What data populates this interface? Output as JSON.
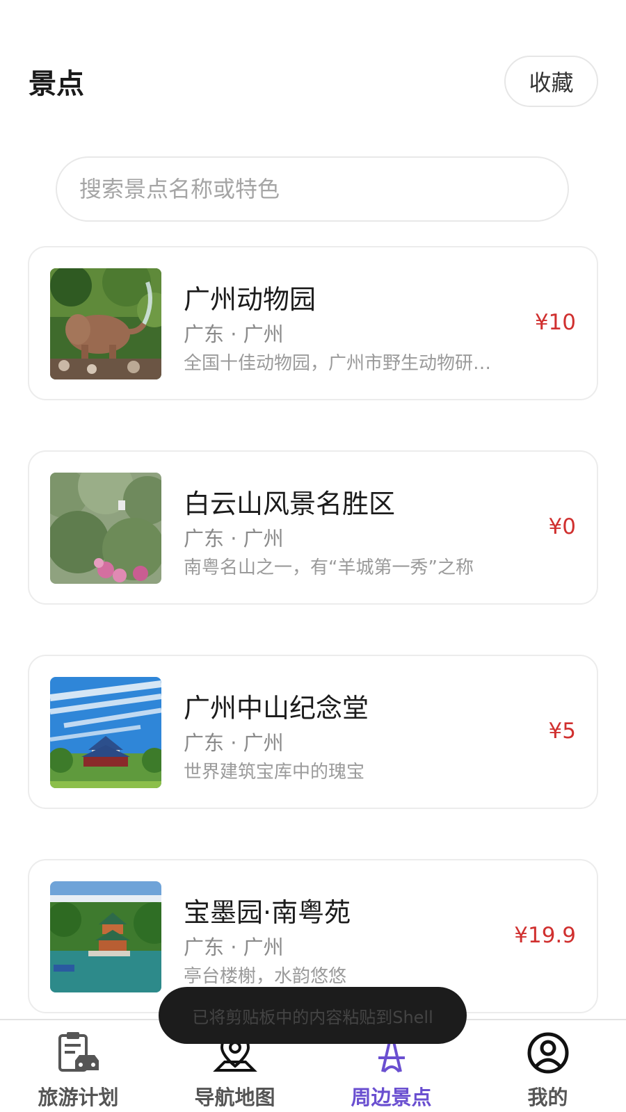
{
  "header": {
    "title": "景点",
    "favorite_label": "收藏"
  },
  "search": {
    "placeholder": "搜索景点名称或特色"
  },
  "attractions": [
    {
      "name": "广州动物园",
      "location": "广东 · 广州",
      "desc": "全国十佳动物园，广州市野生动物研…",
      "price": "¥10"
    },
    {
      "name": "白云山风景名胜区",
      "location": "广东 · 广州",
      "desc": "南粤名山之一，有“羊城第一秀”之称",
      "price": "¥0"
    },
    {
      "name": "广州中山纪念堂",
      "location": "广东 · 广州",
      "desc": "世界建筑宝库中的瑰宝",
      "price": "¥5"
    },
    {
      "name": "宝墨园·南粤苑",
      "location": "广东 · 广州",
      "desc": "亭台楼榭，水韵悠悠",
      "price": "¥19.9"
    }
  ],
  "tabs": [
    {
      "label": "旅游计划",
      "icon": "clipboard-car-icon"
    },
    {
      "label": "导航地图",
      "icon": "map-pin-icon"
    },
    {
      "label": "周边景点",
      "icon": "tower-icon"
    },
    {
      "label": "我的",
      "icon": "user-circle-icon"
    }
  ],
  "active_tab": "周边景点",
  "toast": {
    "text": "已将剪贴板中的内容粘贴到Shell"
  },
  "colors": {
    "price": "#d0302f",
    "active_tab": "#6a4fd0"
  }
}
